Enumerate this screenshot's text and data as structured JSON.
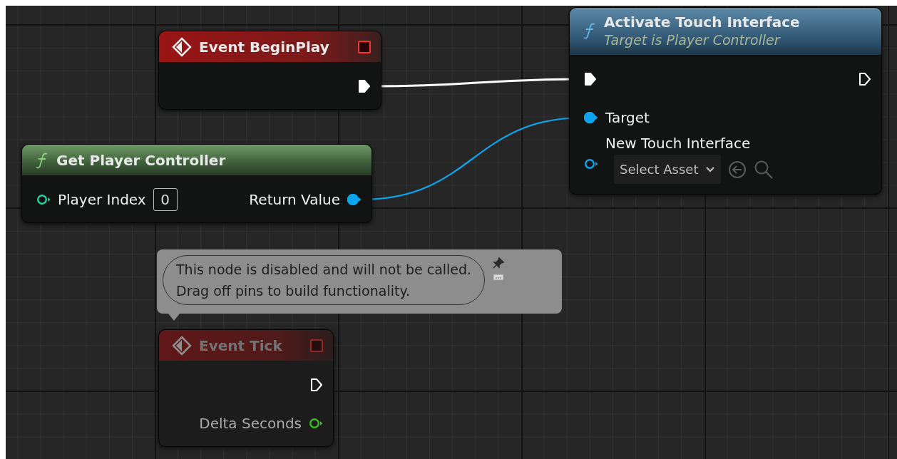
{
  "nodes": [
    {
      "kind": "event",
      "title": "Event BeginPlay",
      "disabled": false,
      "rows": [
        {
          "right": {
            "kind": "exec",
            "connected": true
          }
        }
      ]
    },
    {
      "kind": "function",
      "title": "Activate Touch Interface",
      "subtitle": "Target is Player Controller",
      "disabled": false,
      "rows": [
        {
          "left": {
            "kind": "exec",
            "connected": true
          },
          "right": {
            "kind": "exec",
            "connected": false
          }
        },
        {
          "left": {
            "kind": "object",
            "connected": true,
            "label": "Target"
          }
        },
        {
          "left": {
            "kind": "asset",
            "connected": false,
            "label": "New Touch Interface",
            "picker": "Select Asset"
          }
        }
      ]
    },
    {
      "kind": "pure_function",
      "title": "Get Player Controller",
      "disabled": false,
      "rows": [
        {
          "left": {
            "kind": "int",
            "connected": false,
            "label": "Player Index",
            "value": "0"
          },
          "right": {
            "kind": "object",
            "connected": true,
            "label": "Return Value"
          }
        }
      ]
    },
    {
      "kind": "event",
      "title": "Event Tick",
      "disabled": true,
      "comment": "This node is disabled and will not be called.\nDrag off pins to build functionality.",
      "rows": [
        {
          "right": {
            "kind": "exec",
            "connected": false
          }
        },
        {
          "right": {
            "kind": "float",
            "connected": false,
            "label": "Delta Seconds"
          }
        }
      ]
    }
  ]
}
